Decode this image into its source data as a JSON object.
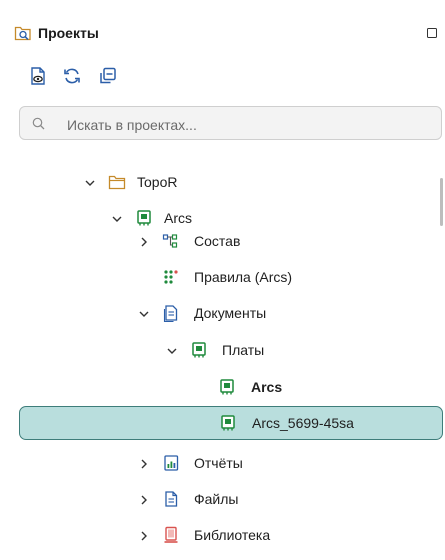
{
  "panel": {
    "title": "Проекты",
    "icon": "projects-search-icon",
    "maximize_icon": "maximize-icon"
  },
  "toolbar": [
    {
      "name": "show-icon"
    },
    {
      "name": "refresh-icon"
    },
    {
      "name": "collapse-all-icon"
    }
  ],
  "search": {
    "placeholder": "Искать в проектах...",
    "value": ""
  },
  "tree": [
    {
      "label": "TopoR",
      "icon": "folder-icon",
      "chevron": "expanded"
    },
    {
      "label": "Arcs",
      "icon": "board-icon",
      "chevron": "expanded"
    },
    {
      "label": "Состав",
      "icon": "structure-icon",
      "chevron": "collapsed"
    },
    {
      "label": "Правила (Arcs)",
      "icon": "rules-icon",
      "chevron": "none"
    },
    {
      "label": "Документы",
      "icon": "documents-icon",
      "chevron": "expanded"
    },
    {
      "label": "Платы",
      "icon": "boards-icon",
      "chevron": "expanded"
    },
    {
      "label": "Arcs",
      "icon": "board-icon",
      "chevron": "none",
      "bold": true
    },
    {
      "label": "Arcs_5699-45sa",
      "icon": "board-icon",
      "chevron": "none",
      "selected": true
    },
    {
      "label": "Отчёты",
      "icon": "reports-icon",
      "chevron": "collapsed"
    },
    {
      "label": "Файлы",
      "icon": "files-icon",
      "chevron": "collapsed"
    },
    {
      "label": "Библиотека",
      "icon": "library-icon",
      "chevron": "collapsed"
    }
  ],
  "colors": {
    "accent_green": "#1f8a3c",
    "folder_orange": "#c58a2a",
    "selection_bg": "#b9dedd",
    "selection_border": "#3e7d7a",
    "library_red": "#d9534f"
  }
}
